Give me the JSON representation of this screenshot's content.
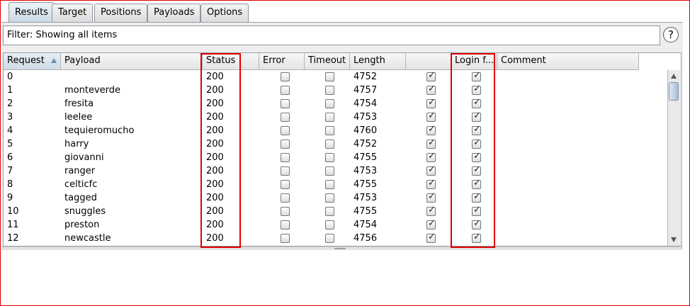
{
  "tabs": [
    {
      "label": "Results",
      "active": true
    },
    {
      "label": "Target",
      "active": false
    },
    {
      "label": "Positions",
      "active": false
    },
    {
      "label": "Payloads",
      "active": false
    },
    {
      "label": "Options",
      "active": false
    }
  ],
  "filter": {
    "text": "Filter: Showing all items"
  },
  "help": {
    "label": "?"
  },
  "columns": [
    "Request",
    "Payload",
    "Status",
    "Error",
    "Timeout",
    "Length",
    "",
    "Login f...",
    "Comment"
  ],
  "rows": [
    {
      "request": "0",
      "payload": "",
      "status": "200",
      "error": false,
      "timeout": false,
      "length": "4752",
      "col7": true,
      "login": true,
      "comment": ""
    },
    {
      "request": "1",
      "payload": "monteverde",
      "status": "200",
      "error": false,
      "timeout": false,
      "length": "4757",
      "col7": true,
      "login": true,
      "comment": ""
    },
    {
      "request": "2",
      "payload": "fresita",
      "status": "200",
      "error": false,
      "timeout": false,
      "length": "4754",
      "col7": true,
      "login": true,
      "comment": ""
    },
    {
      "request": "3",
      "payload": "leelee",
      "status": "200",
      "error": false,
      "timeout": false,
      "length": "4753",
      "col7": true,
      "login": true,
      "comment": ""
    },
    {
      "request": "4",
      "payload": "tequieromucho",
      "status": "200",
      "error": false,
      "timeout": false,
      "length": "4760",
      "col7": true,
      "login": true,
      "comment": ""
    },
    {
      "request": "5",
      "payload": "harry",
      "status": "200",
      "error": false,
      "timeout": false,
      "length": "4752",
      "col7": true,
      "login": true,
      "comment": ""
    },
    {
      "request": "6",
      "payload": "giovanni",
      "status": "200",
      "error": false,
      "timeout": false,
      "length": "4755",
      "col7": true,
      "login": true,
      "comment": ""
    },
    {
      "request": "7",
      "payload": "ranger",
      "status": "200",
      "error": false,
      "timeout": false,
      "length": "4753",
      "col7": true,
      "login": true,
      "comment": ""
    },
    {
      "request": "8",
      "payload": "celticfc",
      "status": "200",
      "error": false,
      "timeout": false,
      "length": "4755",
      "col7": true,
      "login": true,
      "comment": ""
    },
    {
      "request": "9",
      "payload": "tagged",
      "status": "200",
      "error": false,
      "timeout": false,
      "length": "4753",
      "col7": true,
      "login": true,
      "comment": ""
    },
    {
      "request": "10",
      "payload": "snuggles",
      "status": "200",
      "error": false,
      "timeout": false,
      "length": "4755",
      "col7": true,
      "login": true,
      "comment": ""
    },
    {
      "request": "11",
      "payload": "preston",
      "status": "200",
      "error": false,
      "timeout": false,
      "length": "4754",
      "col7": true,
      "login": true,
      "comment": ""
    },
    {
      "request": "12",
      "payload": "newcastle",
      "status": "200",
      "error": false,
      "timeout": false,
      "length": "4756",
      "col7": true,
      "login": true,
      "comment": ""
    }
  ],
  "colors": {
    "highlight": "#e00000",
    "selected_header": "#cfdbe7"
  }
}
